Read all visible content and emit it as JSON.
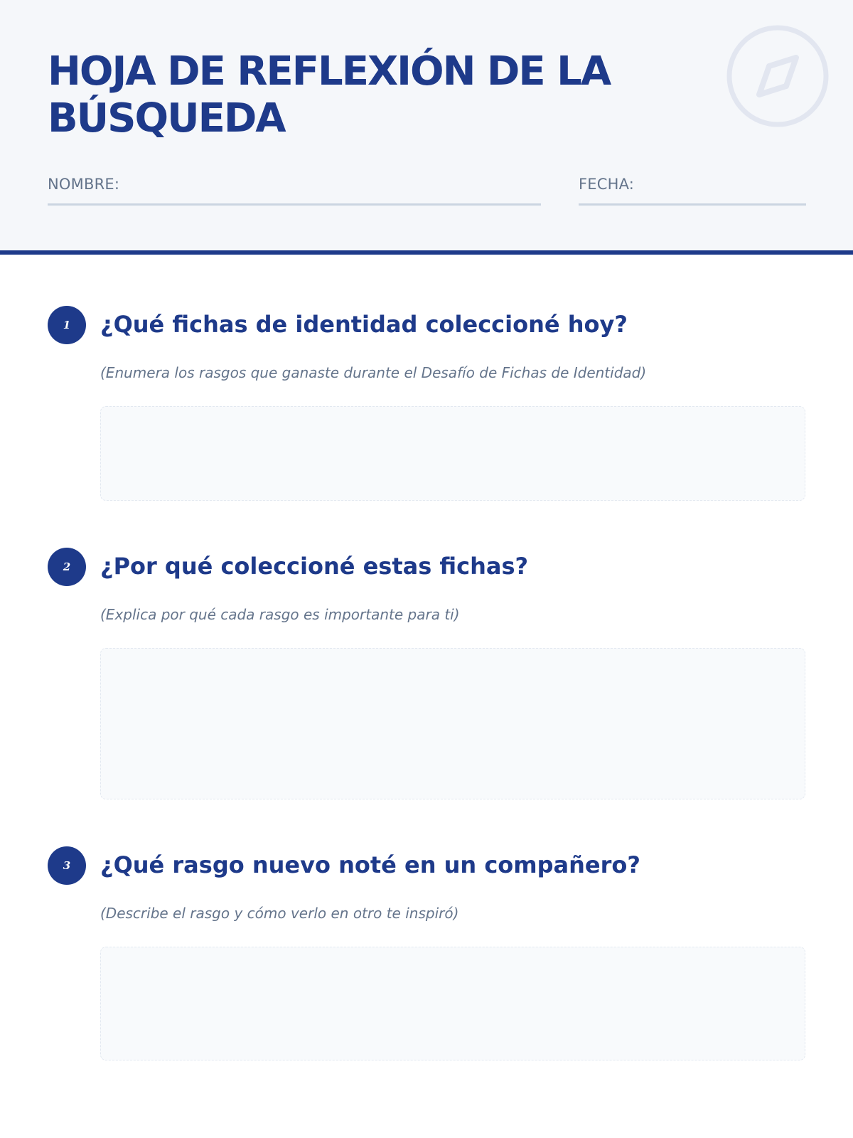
{
  "worksheet": {
    "title": "HOJA DE REFLEXIÓN DE LA BÚSQUEDA",
    "name_label": "NOMBRE:",
    "date_label": "FECHA:"
  },
  "questions": [
    {
      "number": "1",
      "prompt": "¿Qué fichas de identidad coleccioné hoy?",
      "hint": "(Enumera los rasgos que ganaste durante el Desafío de Fichas de Identidad)"
    },
    {
      "number": "2",
      "prompt": "¿Por qué coleccioné estas fichas?",
      "hint": "(Explica por qué cada rasgo es importante para ti)"
    },
    {
      "number": "3",
      "prompt": "¿Qué rasgo nuevo noté en un compañero?",
      "hint": "(Describe el rasgo y cómo verlo en otro te inspiró)"
    }
  ],
  "icons": {
    "header_decoration": "compass-icon"
  },
  "colors": {
    "accent": "#1e3a8a",
    "header_background": "#f5f7fa",
    "muted_text": "#64748b",
    "answer_background": "#f8fafc"
  }
}
